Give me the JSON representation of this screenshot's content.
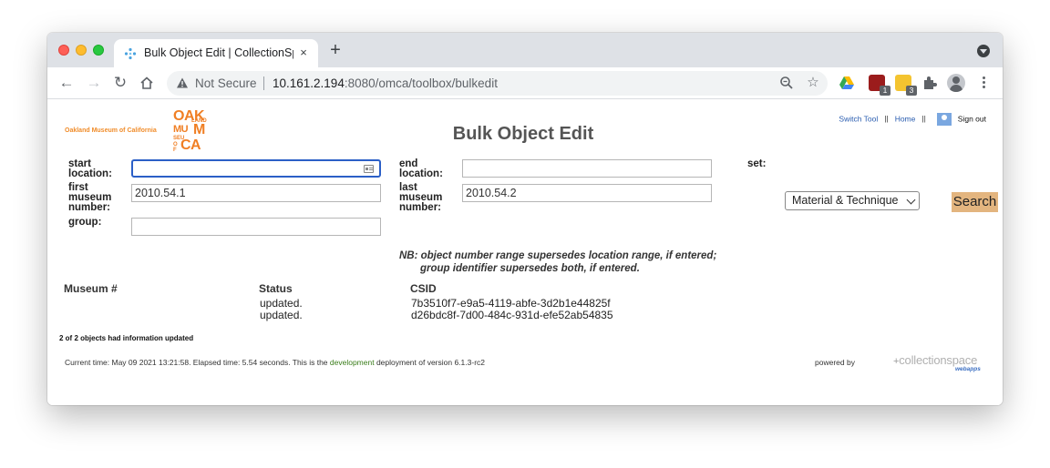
{
  "browser": {
    "tab_title": "Bulk Object Edit | CollectionSpace",
    "tab_close": "×",
    "new_tab": "+",
    "security_label": "Not Secure",
    "url_host": "10.161.2.194",
    "url_path": ":8080/omca/toolbox/bulkedit",
    "extension_badges": [
      "1",
      "3"
    ]
  },
  "header": {
    "org_name": "Oakland Museum of California",
    "logo_letters": {
      "row1": "OAK",
      "land": "LAND",
      "mu": "MU",
      "m": "M",
      "seu": "SEU",
      "of": "OF",
      "ca": "CA"
    },
    "title": "Bulk Object Edit",
    "links": {
      "switch_tool": "Switch Tool",
      "separator": "||",
      "home": "Home",
      "sign_out": "Sign out"
    }
  },
  "form": {
    "start_location_label": "start location:",
    "start_location_value": "",
    "end_location_label": "end location:",
    "end_location_value": "",
    "first_museum_number_label": "first museum number:",
    "first_museum_number_value": "2010.54.1",
    "last_museum_number_label": "last museum number:",
    "last_museum_number_value": "2010.54.2",
    "group_label": "group:",
    "group_value": "",
    "set_label": "set:",
    "set_selected": "Material & Technique",
    "search_button": "Search",
    "note_line1": "NB: object number range supersedes location range, if entered;",
    "note_line2": "group identifier supersedes both, if entered."
  },
  "results": {
    "columns": [
      "Museum #",
      "Status",
      "CSID"
    ],
    "rows": [
      {
        "museum_number": "",
        "status": "updated.",
        "csid": "7b3510f7-e9a5-4119-abfe-3d2b1e44825f"
      },
      {
        "museum_number": "",
        "status": "updated.",
        "csid": "d26bdc8f-7d00-484c-931d-efe52ab54835"
      }
    ],
    "summary": "2 of 2 objects had information updated"
  },
  "footer": {
    "text_before": "Current time: May 09 2021 13:21:58. Elapsed time: 5.54 seconds. This is the ",
    "deployment": "development",
    "text_after": " deployment of version 6.1.3-rc2",
    "powered_by": "powered by",
    "cs_logo_text": "collectionspace",
    "cs_logo_sub": "webapps"
  },
  "colors": {
    "accent_orange": "#f07f24",
    "search_button": "#e3b57f",
    "link_blue": "#2a5db0",
    "focus_blue": "#2b5fc7"
  }
}
